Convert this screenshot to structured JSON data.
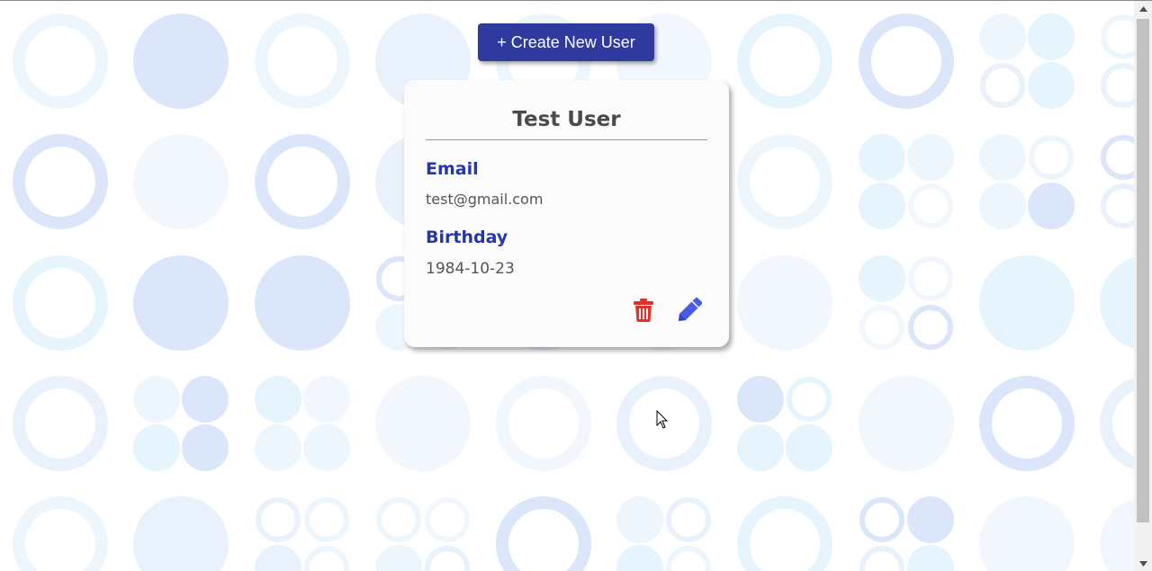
{
  "toolbar": {
    "create_label": "+ Create New User"
  },
  "user_card": {
    "name": "Test User",
    "email_label": "Email",
    "email": "test@gmail.com",
    "birthday_label": "Birthday",
    "birthday": "1984-10-23"
  },
  "icons": {
    "delete": "trash-icon",
    "edit": "pencil-icon"
  },
  "colors": {
    "primary_button": "#2f3a9e",
    "field_label": "#2537a8",
    "delete_icon": "#e0322d",
    "edit_icon": "#4a5be0",
    "background_circle_light": "#e6f4fd",
    "background_circle_blue": "#dbe6fb"
  }
}
